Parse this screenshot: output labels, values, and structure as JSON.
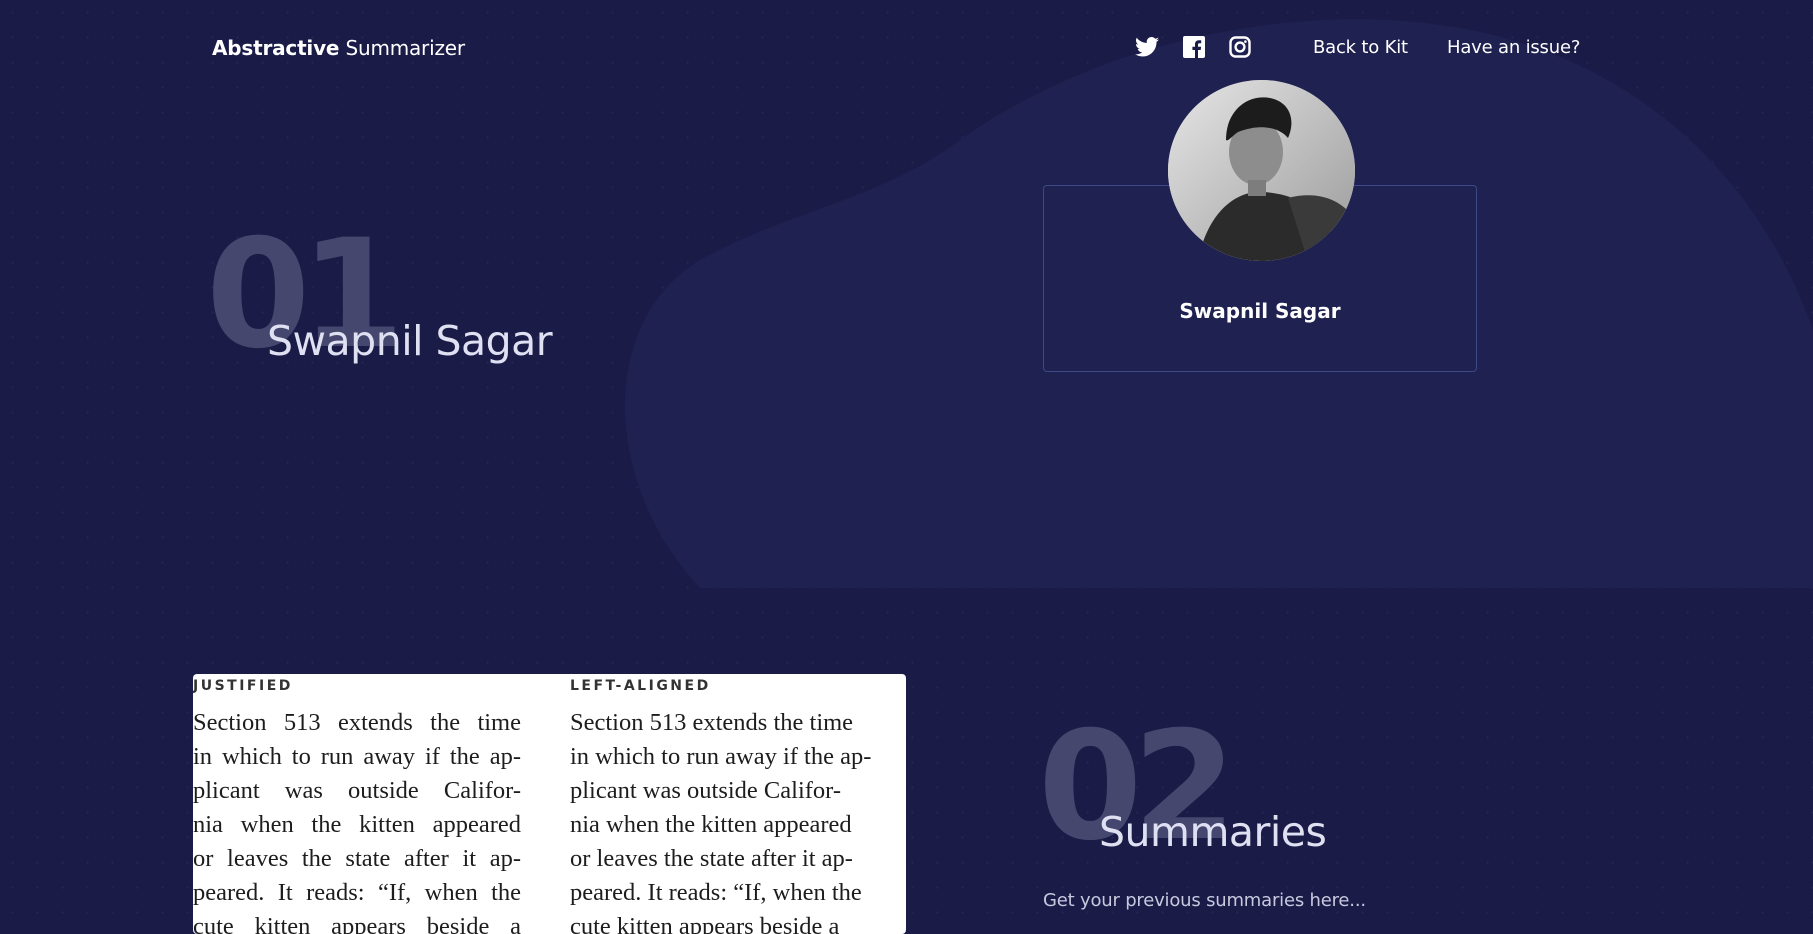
{
  "header": {
    "brand_bold": "Abstractive",
    "brand_light": "Summarizer",
    "social": [
      "twitter-icon",
      "facebook-icon",
      "instagram-icon"
    ],
    "nav": {
      "back": "Back to Kit",
      "issue": "Have an issue?"
    }
  },
  "section1": {
    "number": "01",
    "title": "Swapnil Sagar"
  },
  "profile": {
    "name": "Swapnil Sagar"
  },
  "document": {
    "justified_heading": "JUSTIFIED",
    "left_heading": "LEFT-ALIGNED",
    "lines": [
      "Section 513 extends the time",
      "in which to run away if the ap-",
      "plicant was outside Califor-",
      "nia when the kitten appeared",
      "or leaves the state after it ap-",
      "peared. It reads: “If, when the",
      "cute kitten appears beside a"
    ]
  },
  "section2": {
    "number": "02",
    "title": "Summaries",
    "subtitle": "Get your previous summaries here..."
  },
  "colors": {
    "background": "#1a1b47",
    "blob": "#1f2150",
    "card_border": "#3d4a88",
    "number_fill": "#45476e"
  }
}
